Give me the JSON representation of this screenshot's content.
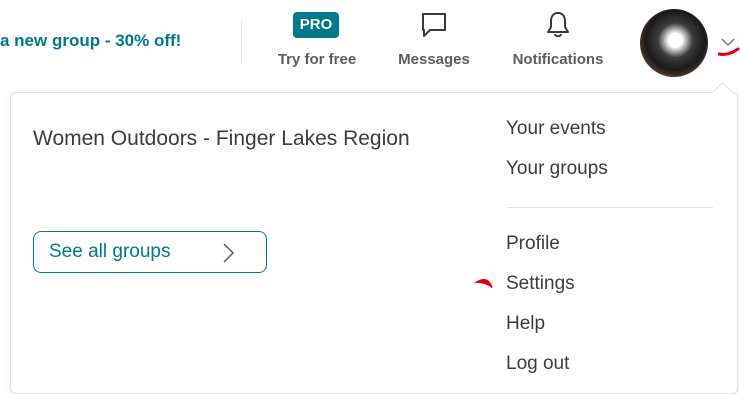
{
  "header": {
    "promo_text": "a new group - 30% off!",
    "pro": {
      "badge": "PRO",
      "label": "Try for free"
    },
    "messages": {
      "label": "Messages",
      "icon": "chat-bubble-icon"
    },
    "notifications": {
      "label": "Notifications",
      "icon": "bell-icon"
    },
    "avatar": {
      "icon": "user-avatar"
    }
  },
  "dropdown": {
    "group_name": "Women Outdoors - Finger Lakes Region",
    "see_all_label": "See all groups",
    "menu": {
      "your_events": "Your events",
      "your_groups": "Your groups",
      "profile": "Profile",
      "settings": "Settings",
      "help": "Help",
      "log_out": "Log out"
    }
  },
  "colors": {
    "accent": "#00798a",
    "annotation": "#e0001b",
    "text": "#3c3c3c",
    "nav_label": "#5c5c5c"
  }
}
